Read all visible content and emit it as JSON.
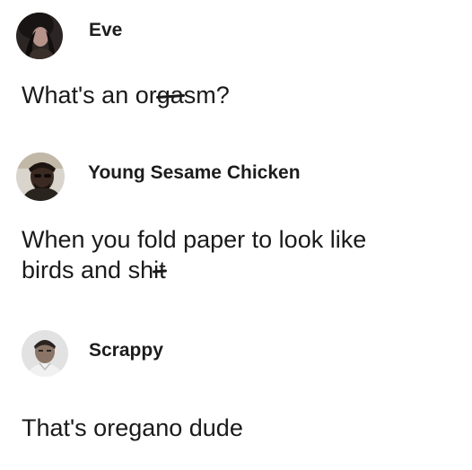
{
  "posts": [
    {
      "username": "Eve",
      "message_parts": [
        "What's an or",
        "ga",
        "sm?"
      ]
    },
    {
      "username": "Young Sesame Chicken",
      "message_line1": "When you fold paper to look like",
      "message_line2_parts": [
        "birds and sh",
        "it"
      ]
    },
    {
      "username": "Scrappy",
      "message": "That's oregano dude"
    }
  ],
  "colors": {
    "background": "#ffffff",
    "text": "#1a1a1a"
  }
}
